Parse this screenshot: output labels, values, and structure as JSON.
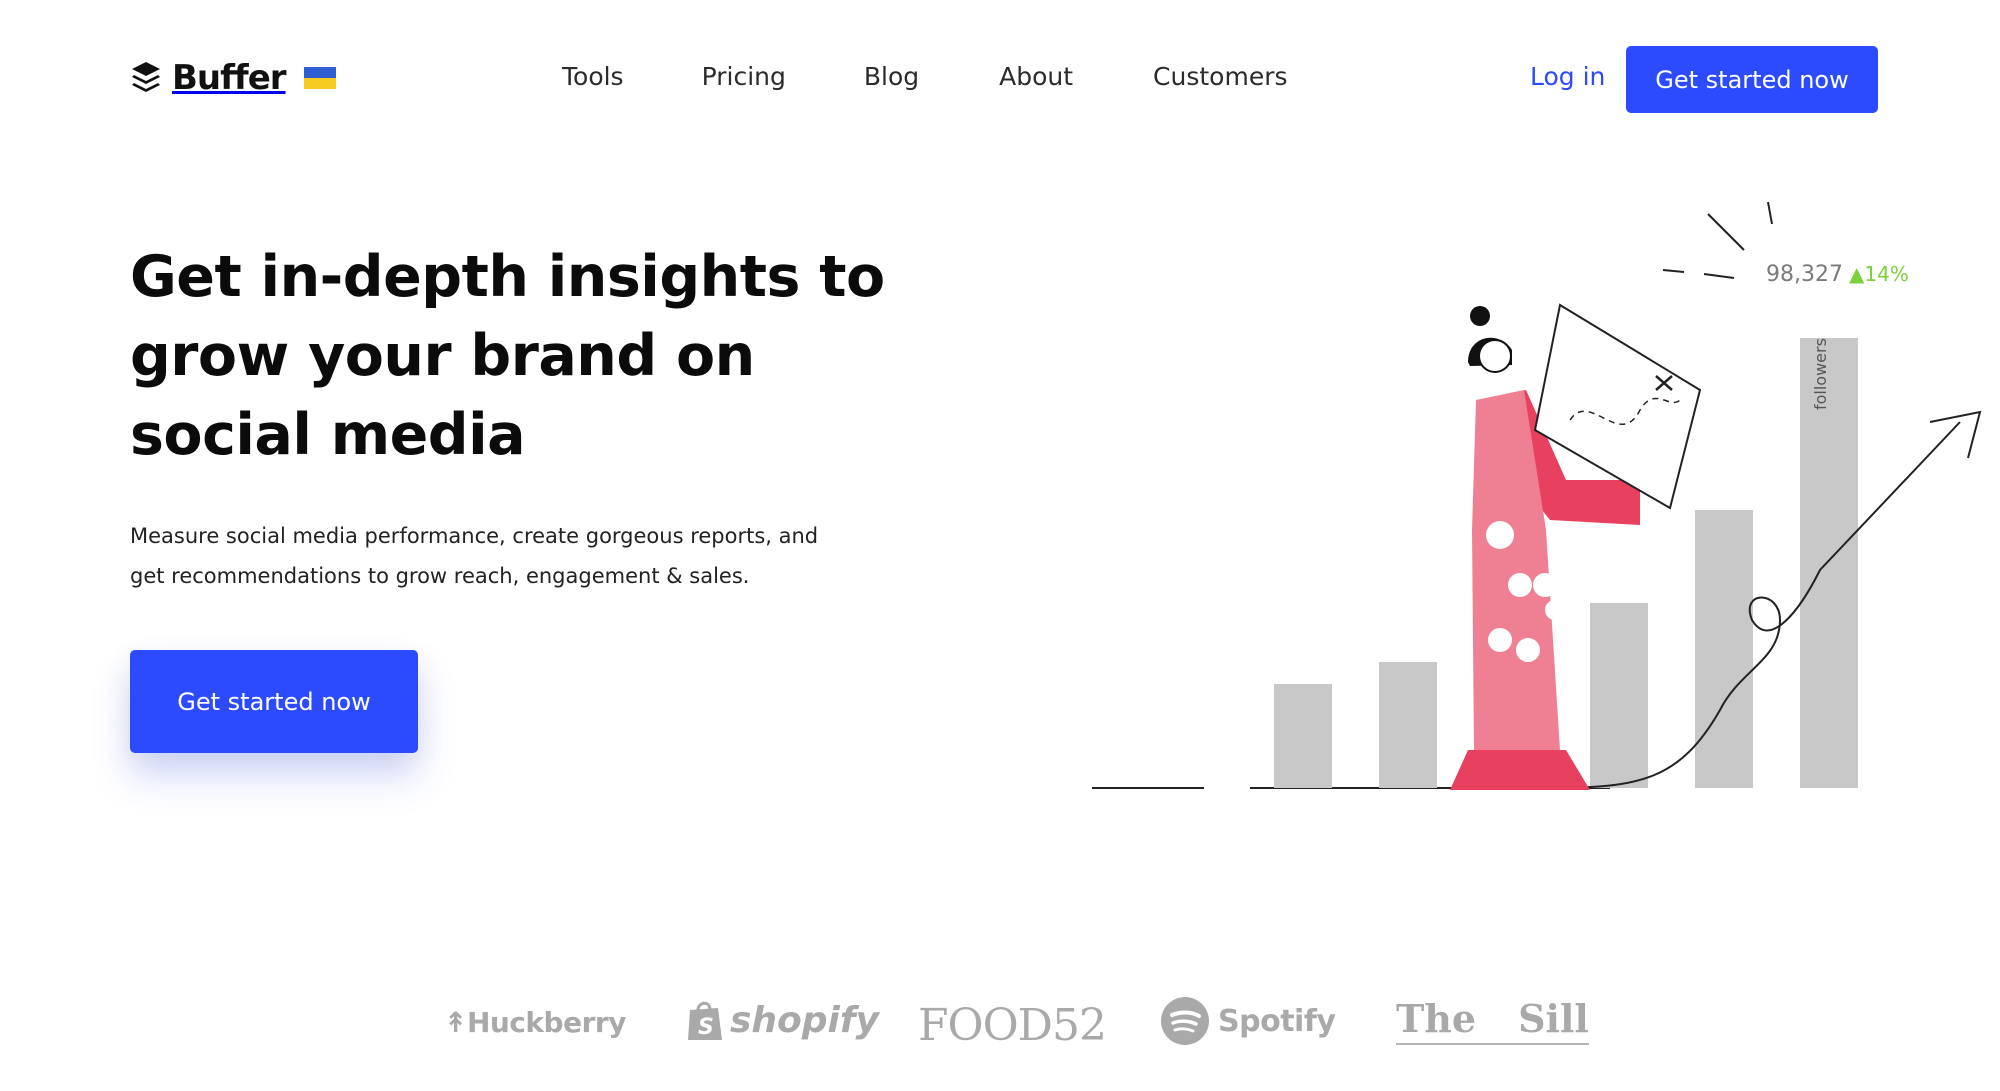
{
  "header": {
    "logo_text": "Buffer",
    "nav": [
      "Tools",
      "Pricing",
      "Blog",
      "About",
      "Customers"
    ],
    "login_label": "Log in",
    "cta_label": "Get started now"
  },
  "hero": {
    "title": "Get in-depth insights to grow your brand on social media",
    "subtitle": "Measure social media performance, create gorgeous reports, and get recommendations to grow reach, engagement & sales.",
    "cta_label": "Get started now"
  },
  "illustration": {
    "stat_value": "98,327",
    "stat_change": "14%",
    "bar_label": "followers"
  },
  "customers": {
    "logos": [
      "Huckberry",
      "shopify",
      "FOOD52",
      "Spotify",
      "The",
      "Sill"
    ]
  },
  "colors": {
    "accent": "#2c4bff",
    "logo_gray": "#a9a9a9",
    "bar_gray": "#c8c8c8",
    "figure_red": "#e8415f",
    "figure_pink": "#ef7f93",
    "stat_green": "#7bd13a"
  },
  "icons": [
    "buffer-logo-icon",
    "ukraine-flag-icon",
    "shopify-bag-icon",
    "spotify-icon"
  ]
}
